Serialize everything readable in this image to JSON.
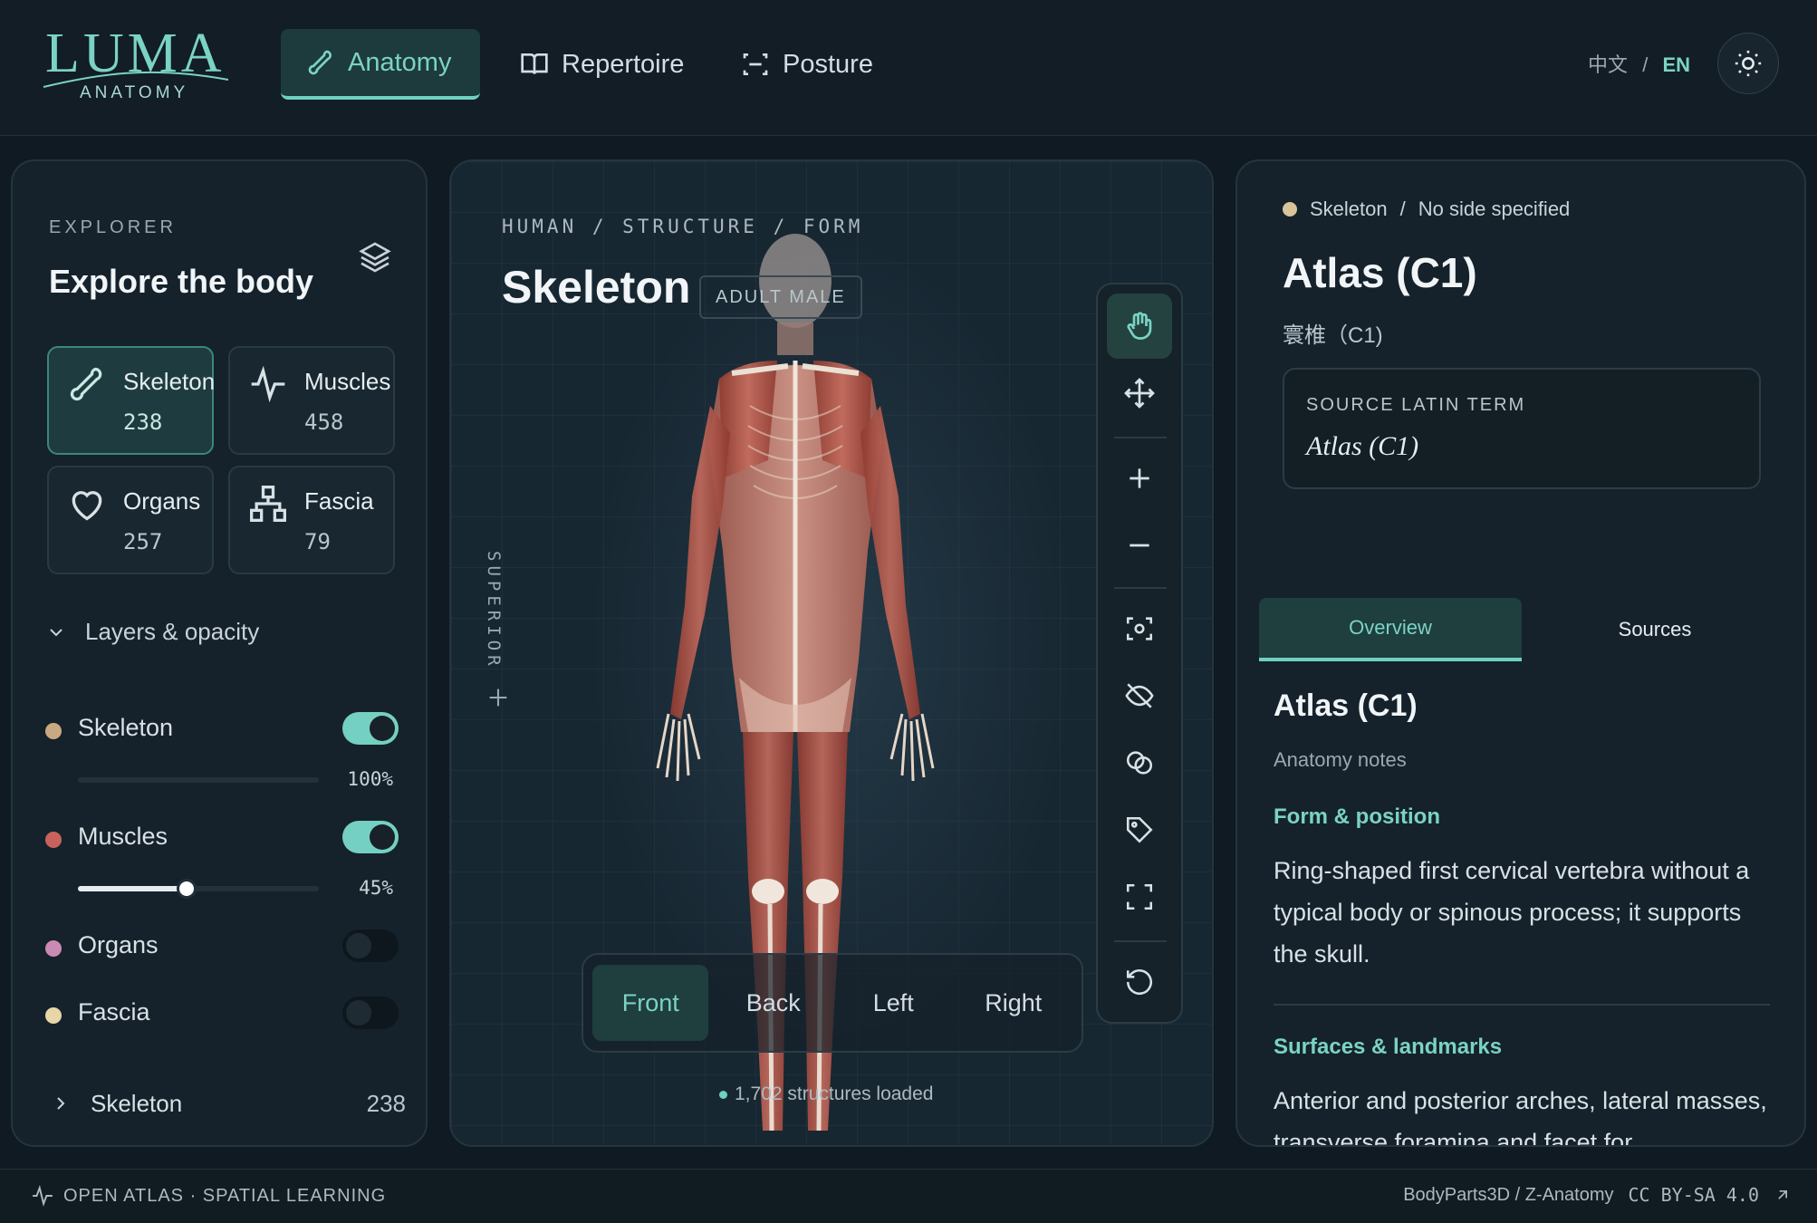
{
  "brand": {
    "name": "LUMA",
    "sub": "ANATOMY"
  },
  "nav": [
    {
      "label": "Anatomy",
      "icon": "bone-icon",
      "active": true
    },
    {
      "label": "Repertoire",
      "icon": "book-icon",
      "active": false
    },
    {
      "label": "Posture",
      "icon": "scan-icon",
      "active": false
    }
  ],
  "lang": {
    "zh": "中文",
    "sep": "/",
    "en": "EN"
  },
  "explorer": {
    "eyebrow": "EXPLORER",
    "title": "Explore the body",
    "categories": [
      {
        "label": "Skeleton",
        "count": "238",
        "icon": "bone-icon",
        "active": true
      },
      {
        "label": "Muscles",
        "count": "458",
        "icon": "pulse-icon",
        "active": false
      },
      {
        "label": "Organs",
        "count": "257",
        "icon": "heart-icon",
        "active": false
      },
      {
        "label": "Fascia",
        "count": "79",
        "icon": "network-icon",
        "active": false
      }
    ],
    "layers_heading": "Layers & opacity",
    "layers": [
      {
        "name": "Skeleton",
        "color": "#c9a982",
        "on": true,
        "opacity": 1.0,
        "pct": "100%"
      },
      {
        "name": "Muscles",
        "color": "#c8625c",
        "on": true,
        "opacity": 0.45,
        "pct": "45%"
      },
      {
        "name": "Organs",
        "color": "#c98bb3",
        "on": false
      },
      {
        "name": "Fascia",
        "color": "#e8d6a8",
        "on": false
      }
    ],
    "tree": {
      "label": "Skeleton",
      "count": "238"
    }
  },
  "viewer": {
    "breadcrumb": "HUMAN / STRUCTURE / FORM",
    "title": "Skeleton",
    "badge": "ADULT MALE",
    "orientation": "SUPERIOR",
    "views": [
      {
        "label": "Front",
        "active": true
      },
      {
        "label": "Back",
        "active": false
      },
      {
        "label": "Left",
        "active": false
      },
      {
        "label": "Right",
        "active": false
      }
    ],
    "loaded": "1,702 structures loaded"
  },
  "detail": {
    "crumb_system": "Skeleton",
    "crumb_sep": "/",
    "crumb_side": "No side specified",
    "title": "Atlas (C1)",
    "zh_name": "寰椎（C1)",
    "latin_label": "SOURCE LATIN TERM",
    "latin_value": "Atlas (C1)",
    "tabs": [
      {
        "label": "Overview",
        "active": true
      },
      {
        "label": "Sources",
        "active": false
      }
    ],
    "overview_title": "Atlas (C1)",
    "overview_sub": "Anatomy notes",
    "sections": [
      {
        "heading": "Form & position",
        "text": "Ring-shaped first cervical vertebra without a typical body or spinous process; it supports the skull."
      },
      {
        "heading": "Surfaces & landmarks",
        "text": "Anterior and posterior arches, lateral masses, transverse foramina and facet for"
      }
    ]
  },
  "footer": {
    "left": "OPEN ATLAS · SPATIAL LEARNING",
    "right": "BodyParts3D / Z-Anatomy",
    "license": "CC BY-SA 4.0"
  }
}
